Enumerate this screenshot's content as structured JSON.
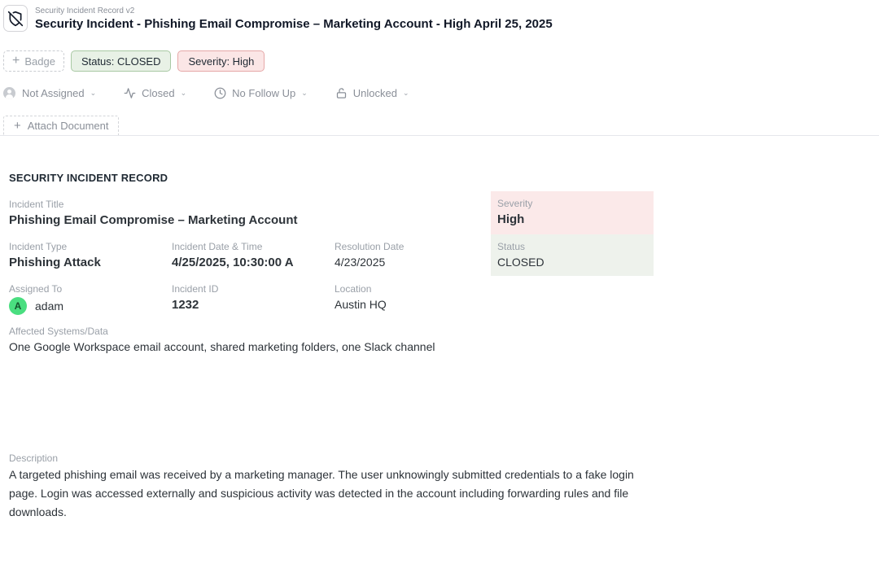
{
  "header": {
    "subtitle": "Security Incident Record v2",
    "title": "Security Incident - Phishing Email Compromise – Marketing Account - High April 25, 2025"
  },
  "badges": {
    "add_label": "Badge",
    "status": "Status: CLOSED",
    "severity": "Severity: High"
  },
  "properties": {
    "assignee": "Not Assigned",
    "state": "Closed",
    "follow_up": "No Follow Up",
    "lock": "Unlocked"
  },
  "attach_label": "Attach Document",
  "record": {
    "section_title": "SECURITY INCIDENT RECORD",
    "incident_title": {
      "label": "Incident Title",
      "value": "Phishing Email Compromise – Marketing Account"
    },
    "severity": {
      "label": "Severity",
      "value": "High"
    },
    "status": {
      "label": "Status",
      "value": "CLOSED"
    },
    "incident_type": {
      "label": "Incident Type",
      "value": "Phishing Attack"
    },
    "incident_datetime": {
      "label": "Incident Date & Time",
      "value": "4/25/2025, 10:30:00 A"
    },
    "resolution_date": {
      "label": "Resolution Date",
      "value": "4/23/2025"
    },
    "assigned_to": {
      "label": "Assigned To",
      "initial": "A",
      "value": "adam"
    },
    "incident_id": {
      "label": "Incident ID",
      "value": "1232"
    },
    "location": {
      "label": "Location",
      "value": "Austin HQ"
    },
    "affected": {
      "label": "Affected Systems/Data",
      "value": "One Google Workspace email account, shared marketing folders, one Slack channel"
    },
    "description": {
      "label": "Description",
      "value": "A targeted phishing email was received by a marketing manager. The user unknowingly submitted credentials to a fake login page. Login was accessed externally and suspicious activity was detected in the account including forwarding rules and file downloads."
    }
  },
  "colors": {
    "status_green_bg": "#e8f1e6",
    "severity_red_bg": "#fbe6e6",
    "avatar_green": "#4ade80"
  }
}
